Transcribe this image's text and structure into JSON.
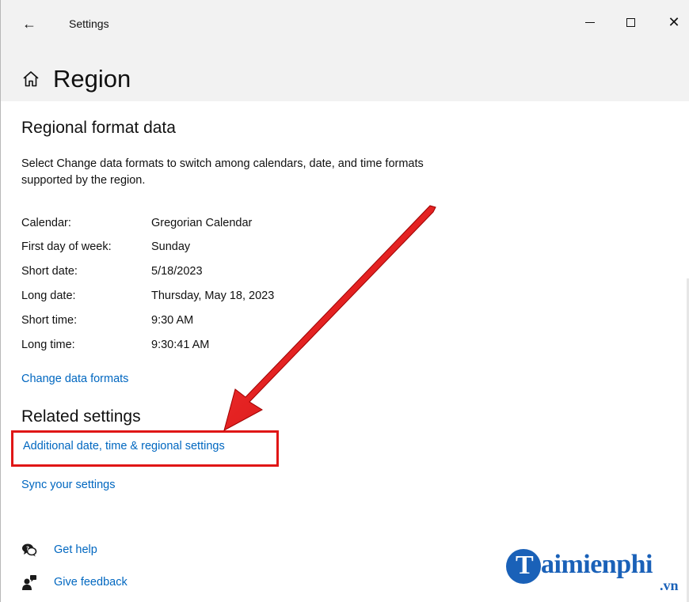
{
  "titlebar": {
    "back_glyph": "←",
    "title": "Settings",
    "minimize_icon": "minimize-icon",
    "maximize_icon": "maximize-icon",
    "close_glyph": "✕"
  },
  "header": {
    "home_icon": "home-icon",
    "title": "Region"
  },
  "regional_format": {
    "title": "Regional format data",
    "description": "Select Change data formats to switch among calendars, date, and time formats supported by the region.",
    "rows": [
      {
        "label": "Calendar:",
        "value": "Gregorian Calendar"
      },
      {
        "label": "First day of week:",
        "value": "Sunday"
      },
      {
        "label": "Short date:",
        "value": "5/18/2023"
      },
      {
        "label": "Long date:",
        "value": "Thursday, May 18, 2023"
      },
      {
        "label": "Short time:",
        "value": "9:30 AM"
      },
      {
        "label": "Long time:",
        "value": "9:30:41 AM"
      }
    ],
    "change_link": "Change data formats"
  },
  "related": {
    "title": "Related settings",
    "additional_link": "Additional date, time & regional settings",
    "sync_link": "Sync your settings"
  },
  "help": {
    "get_help": "Get help",
    "give_feedback": "Give feedback"
  },
  "annotation": {
    "arrow_color": "#e01616",
    "highlight_color": "#e01616"
  },
  "watermark": {
    "initial": "T",
    "text": "aimienphi",
    "suffix": ".vn",
    "color": "#1a61b8"
  },
  "colors": {
    "link": "#0067c0",
    "header_bg": "#f2f2f2"
  }
}
